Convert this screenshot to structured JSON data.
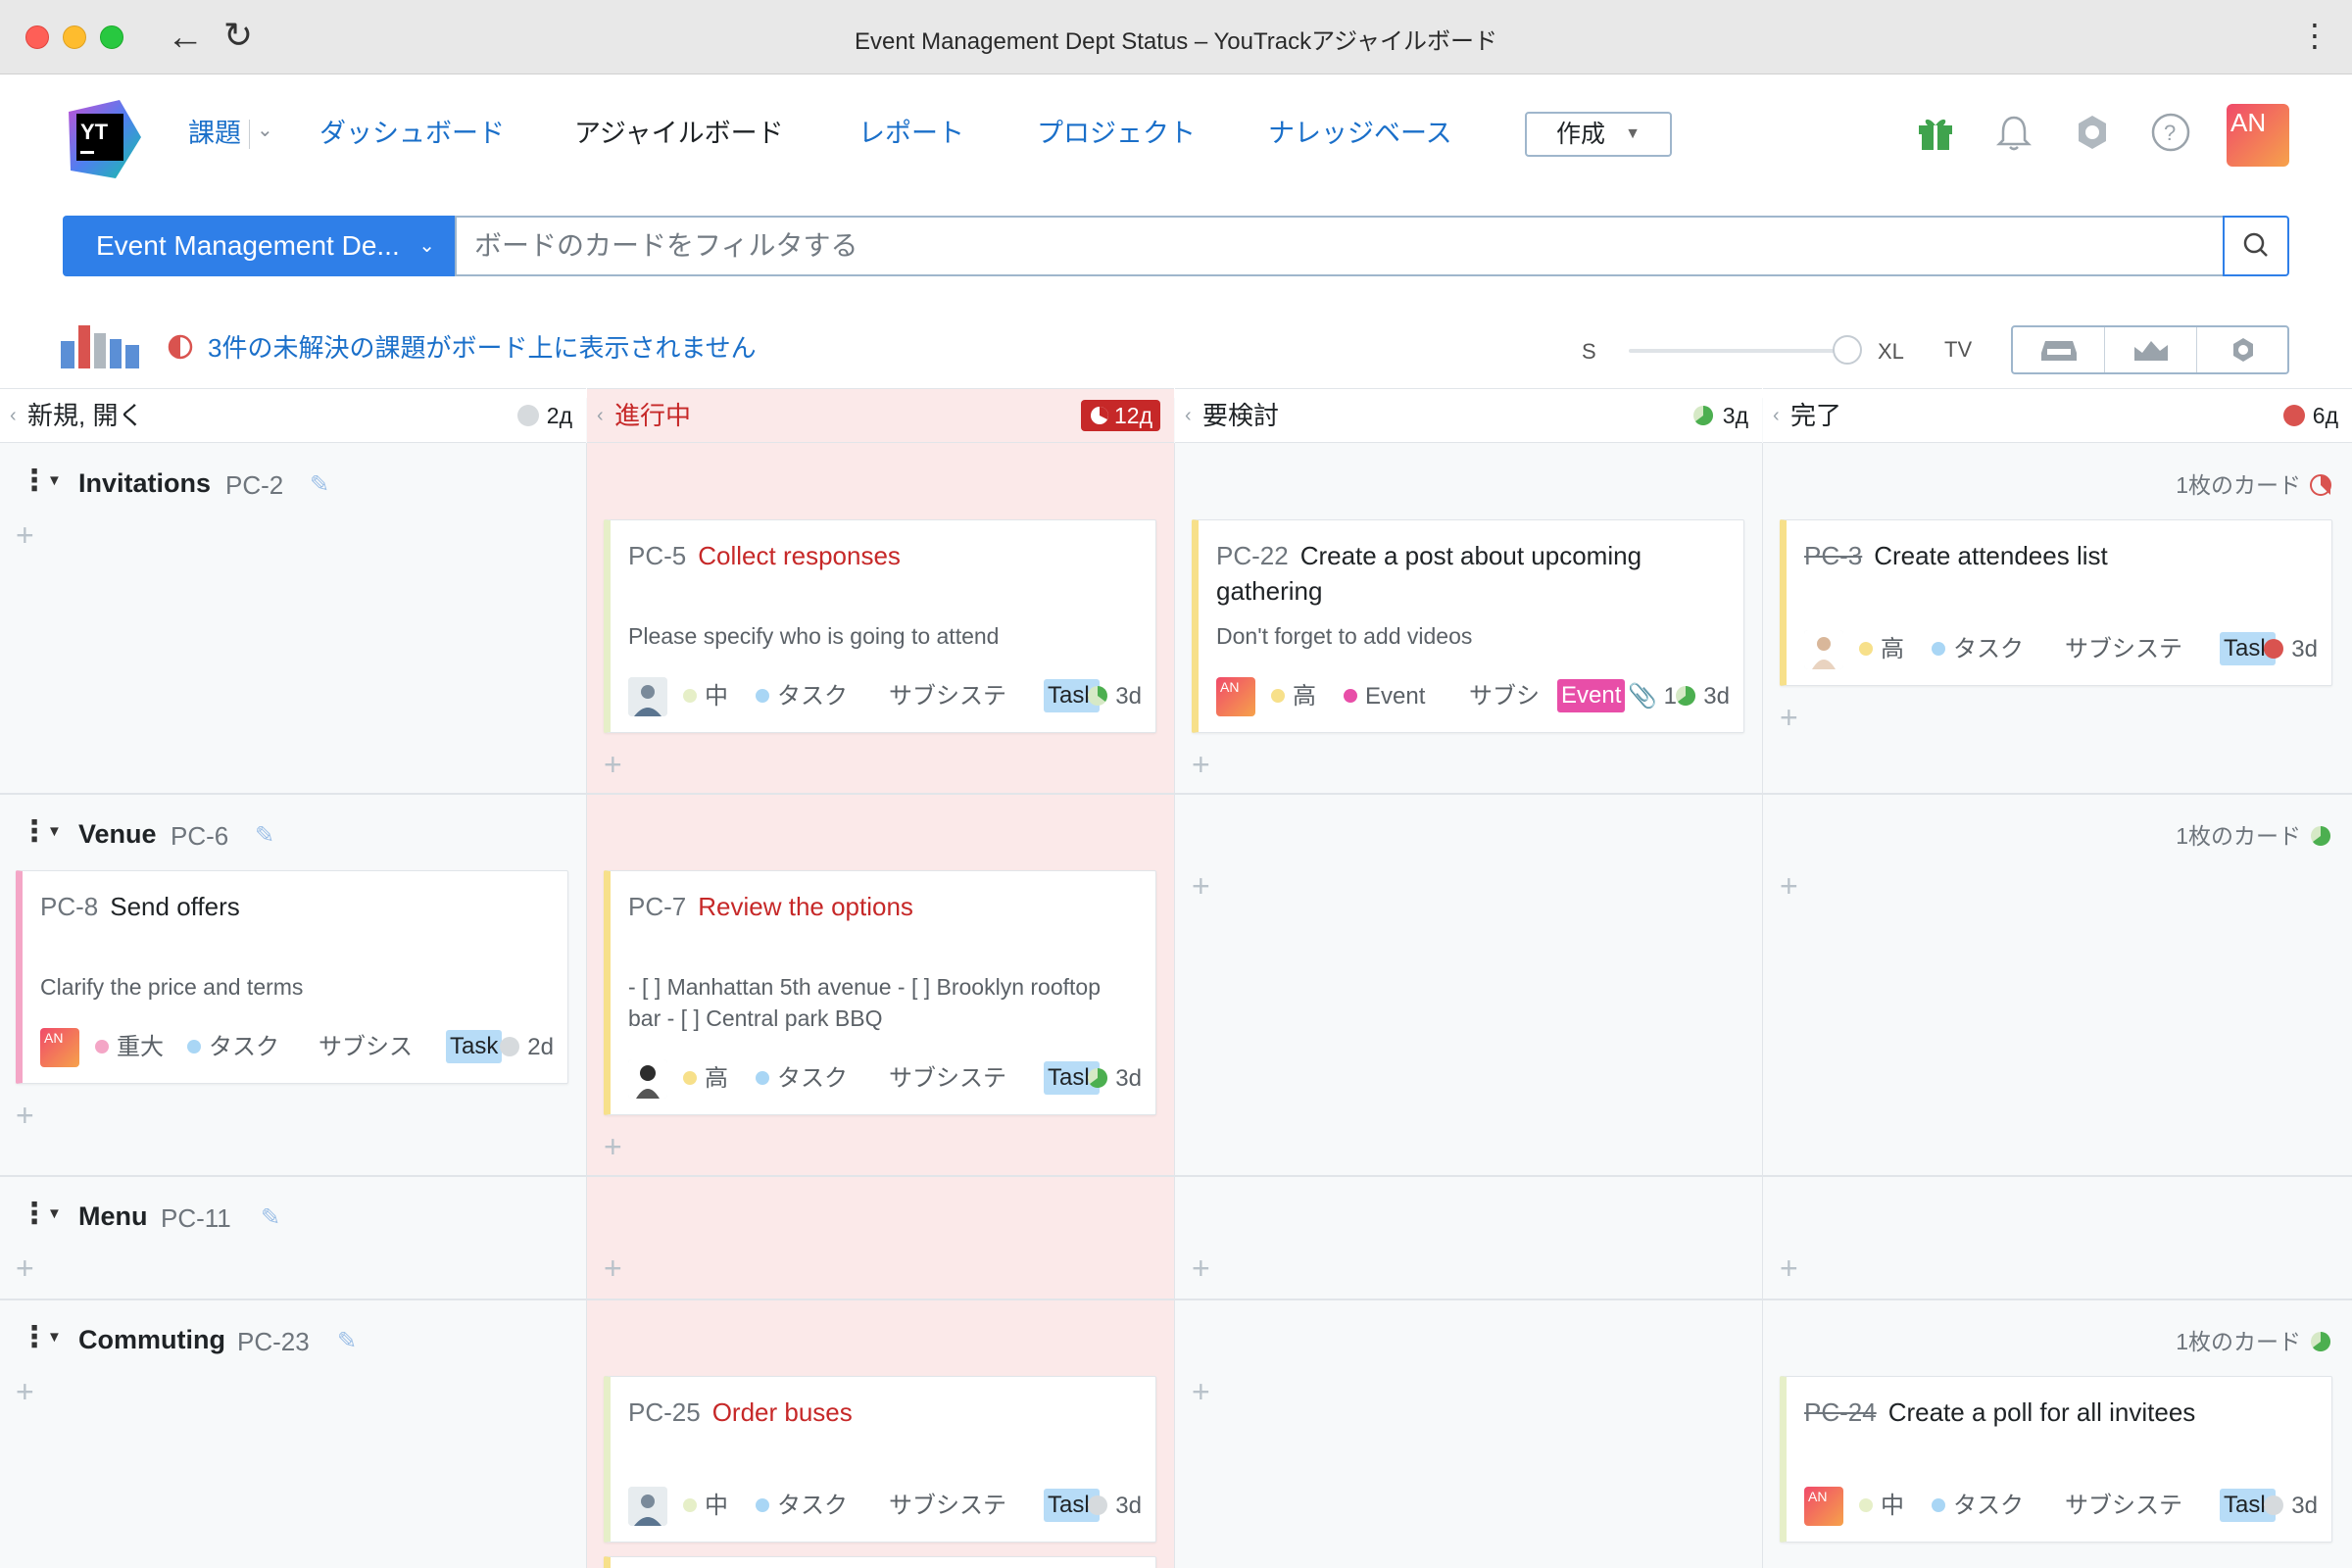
{
  "window": {
    "title": "Event Management Dept Status – YouTrackアジャイルボード",
    "back_icon": "arrow-left-icon",
    "reload_icon": "reload-icon",
    "menu_icon": "kebab-icon"
  },
  "nav": {
    "issues": "課題",
    "dashboards": "ダッシュボード",
    "agile_boards": "アジャイルボード",
    "reports": "レポート",
    "projects": "プロジェクト",
    "knowledge_base": "ナレッジベース",
    "create": "作成"
  },
  "user": {
    "initials": "AN"
  },
  "board_selector": "Event Management De...",
  "search": {
    "placeholder": "ボードのカードをフィルタする"
  },
  "warning": "3件の未解決の課題がボード上に表示されません",
  "card_size": {
    "small": "S",
    "large": "XL",
    "tv": "TV"
  },
  "columns": [
    {
      "name": "新規, 開く",
      "count": "2д",
      "indicator": "grey"
    },
    {
      "name": "進行中",
      "count": "12д",
      "indicator": "red"
    },
    {
      "name": "要検討",
      "count": "3д",
      "indicator": "green"
    },
    {
      "name": "完了",
      "count": "6д",
      "indicator": "red"
    }
  ],
  "swimlanes": [
    {
      "name": "Invitations",
      "id": "PC-2",
      "card_count": "1枚のカード"
    },
    {
      "name": "Venue",
      "id": "PC-6",
      "card_count": "1枚のカード"
    },
    {
      "name": "Menu",
      "id": "PC-11"
    },
    {
      "name": "Commuting",
      "id": "PC-23",
      "card_count": "1枚のカード"
    }
  ],
  "cards": {
    "pc5": {
      "id": "PC-5",
      "title": "Collect responses",
      "desc": "Please specify who is going to attend",
      "priority": "中",
      "type": "タスク",
      "subsystem": "サブシステ",
      "tag": "Task",
      "estimate": "3d"
    },
    "pc22": {
      "id": "PC-22",
      "title": "Create a post about upcoming gathering",
      "desc": "Don't forget to add videos",
      "avatar": "AN",
      "priority": "高",
      "type": "Event",
      "subsystem": "サブシ",
      "tag": "Event",
      "attachments": "1",
      "estimate": "3d"
    },
    "pc3": {
      "id": "PC-3",
      "title": "Create attendees list",
      "priority": "高",
      "type": "タスク",
      "subsystem": "サブシステ",
      "tag": "Task",
      "estimate": "3d"
    },
    "pc8": {
      "id": "PC-8",
      "title": "Send offers",
      "desc": "Clarify the price and terms",
      "avatar": "AN",
      "priority": "重大",
      "type": "タスク",
      "subsystem": "サブシス",
      "tag": "Task",
      "estimate": "2d"
    },
    "pc7": {
      "id": "PC-7",
      "title": "Review the options",
      "desc": "- [ ] Manhattan 5th avenue - [ ] Brooklyn rooftop bar - [ ] Central park BBQ",
      "priority": "高",
      "type": "タスク",
      "subsystem": "サブシステ",
      "tag": "Task",
      "estimate": "3d"
    },
    "pc25": {
      "id": "PC-25",
      "title": "Order buses",
      "priority": "中",
      "type": "タスク",
      "subsystem": "サブシステ",
      "tag": "Task",
      "estimate": "3d"
    },
    "pc24": {
      "id": "PC-24",
      "title": "Create a poll for all invitees",
      "avatar": "AN",
      "priority": "中",
      "type": "タスク",
      "subsystem": "サブシステ",
      "tag": "Task",
      "estimate": "3d"
    }
  },
  "colors": {
    "accent": "#2f7fe8",
    "in_progress": "#c62828",
    "in_progress_bg": "#fbe9e9",
    "priority_high": "#f7e08a",
    "priority_mid": "#e6efc8",
    "priority_critical": "#f4a6c6",
    "task_tag": "#b7dcf7",
    "event_tag": "#e84ea8"
  }
}
